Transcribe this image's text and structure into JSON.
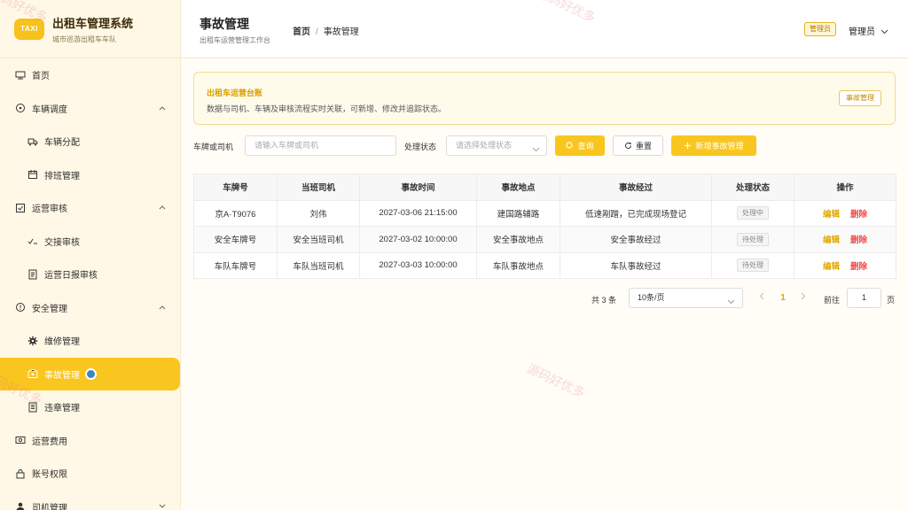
{
  "brand": {
    "logo": "TAXI",
    "title": "出租车管理系统",
    "subtitle": "城市巡游出租车车队"
  },
  "sidebar": {
    "items": [
      {
        "label": "首页",
        "icon": "monitor-icon"
      },
      {
        "label": "车辆调度",
        "icon": "steering-icon"
      },
      {
        "label": "车辆分配",
        "icon": "truck-icon"
      },
      {
        "label": "排班管理",
        "icon": "calendar-icon"
      },
      {
        "label": "运营审核",
        "icon": "checkbox-icon"
      },
      {
        "label": "交接审核",
        "icon": "check-list-icon"
      },
      {
        "label": "运营日报审核",
        "icon": "report-icon"
      },
      {
        "label": "安全管理",
        "icon": "warning-icon"
      },
      {
        "label": "维修管理",
        "icon": "gear-icon"
      },
      {
        "label": "事故管理",
        "icon": "first-aid-icon"
      },
      {
        "label": "违章管理",
        "icon": "document-icon"
      },
      {
        "label": "运营费用",
        "icon": "money-icon"
      },
      {
        "label": "账号权限",
        "icon": "lock-icon"
      },
      {
        "label": "司机管理",
        "icon": "user-icon"
      }
    ]
  },
  "header": {
    "title": "事故管理",
    "subtitle": "出租车运营管理工作台",
    "breadcrumb_home": "首页",
    "breadcrumb_sep": "/",
    "breadcrumb_current": "事故管理",
    "role_badge": "管理员",
    "user_name": "管理员"
  },
  "banner": {
    "title": "出租车运营台账",
    "description": "数据与司机、车辆及审核流程实时关联，可新增、修改并追踪状态。",
    "tag": "事故管理"
  },
  "filter": {
    "plate_label": "车牌或司机",
    "plate_placeholder": "请输入车牌或司机",
    "status_label": "处理状态",
    "status_placeholder": "请选择处理状态",
    "search_label": "查询",
    "reset_label": "重置",
    "add_label": "新增事故管理"
  },
  "table": {
    "columns": [
      "车牌号",
      "当班司机",
      "事故时间",
      "事故地点",
      "事故经过",
      "处理状态",
      "操作"
    ],
    "rows": [
      [
        "京A·T9076",
        "刘伟",
        "2027-03-06 21:15:00",
        "建国路辅路",
        "低速剐蹭，已完成现场登记",
        "处理中"
      ],
      [
        "安全车牌号",
        "安全当班司机",
        "2027-03-02 10:00:00",
        "安全事故地点",
        "安全事故经过",
        "待处理"
      ],
      [
        "车队车牌号",
        "车队当班司机",
        "2027-03-03 10:00:00",
        "车队事故地点",
        "车队事故经过",
        "待处理"
      ]
    ],
    "edit_label": "编辑",
    "delete_label": "删除"
  },
  "pagination": {
    "total": "共 3 条",
    "page_size": "10条/页",
    "current_page": "1",
    "goto_label": "前往",
    "goto_value": "1",
    "page_suffix": "页"
  },
  "watermark": "源码好优多",
  "colors": {
    "accent": "#f9c620",
    "danger": "#f04848",
    "sidebar_bg": "#fff8e6"
  }
}
